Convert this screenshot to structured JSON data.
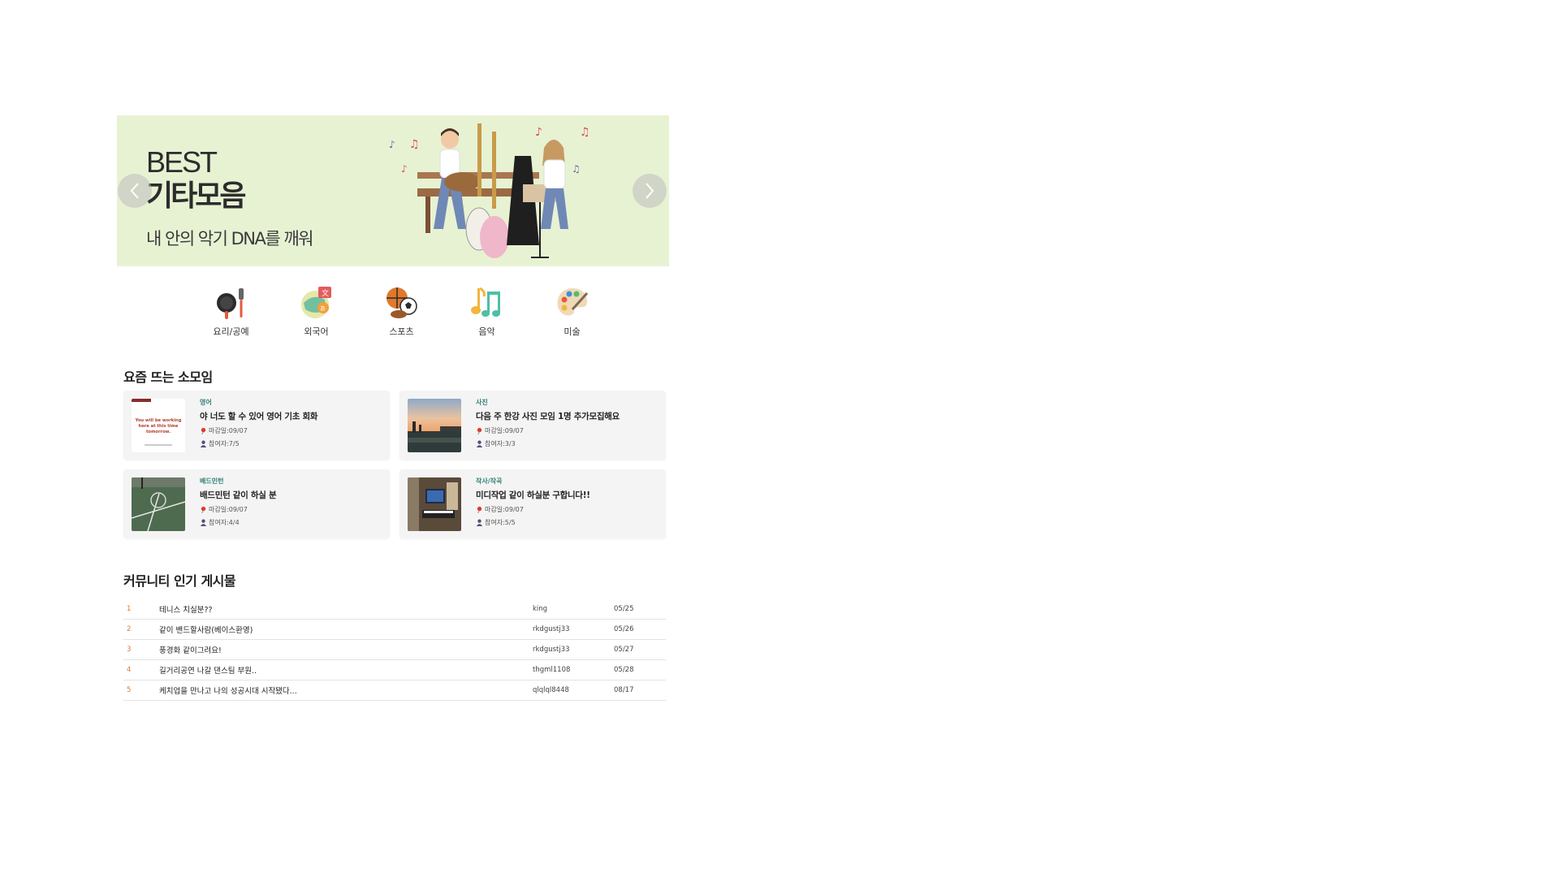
{
  "banner": {
    "best": "BEST",
    "title": "기타모음",
    "subtitle": "내 안의 악기 DNA를 깨워",
    "background": "#e7f2d3"
  },
  "categories": [
    {
      "label": "요리/공예",
      "icon": "frying-pan-icon"
    },
    {
      "label": "외국어",
      "icon": "language-globe-icon"
    },
    {
      "label": "스포츠",
      "icon": "sports-balls-icon"
    },
    {
      "label": "음악",
      "icon": "music-notes-icon"
    },
    {
      "label": "미술",
      "icon": "palette-icon"
    }
  ],
  "meetups": {
    "title": "요즘 뜨는 소모임",
    "deadline_prefix": "마감일: ",
    "members_prefix": "참여자: ",
    "items": [
      {
        "category": "영어",
        "title": "야 너도 할 수 있어 영어 기초 회화",
        "deadline": "09/07",
        "members": "7/5",
        "thumb_text": "You will be working here at this time tomorrow."
      },
      {
        "category": "사진",
        "title": "다음 주 한강 사진 모임 1명 추가모집해요",
        "deadline": "09/07",
        "members": "3/3"
      },
      {
        "category": "배드민턴",
        "title": "배드민턴 같이 하실 분",
        "deadline": "09/07",
        "members": "4/4"
      },
      {
        "category": "작사/작곡",
        "title": "미디작업 같이 하실분 구합니다!!",
        "deadline": "09/07",
        "members": "5/5"
      }
    ]
  },
  "community": {
    "title": "커뮤니티 인기 게시물",
    "posts": [
      {
        "num": "1",
        "title": "테니스 치실분??",
        "author": "king",
        "date": "05/25"
      },
      {
        "num": "2",
        "title": "같이 밴드할사람(베이스환영)",
        "author": "rkdgustj33",
        "date": "05/26"
      },
      {
        "num": "3",
        "title": "풍경화 같이그려요!",
        "author": "rkdgustj33",
        "date": "05/27"
      },
      {
        "num": "4",
        "title": "길거리공연 나갈 댄스팀 부원..",
        "author": "thgml1108",
        "date": "05/28"
      },
      {
        "num": "5",
        "title": "케치업을 만나고 나의 성공시대 시작됐다...",
        "author": "qlqlql8448",
        "date": "08/17"
      }
    ]
  },
  "colors": {
    "accent_number": "#e07b2c",
    "category_tag": "#2f7f76",
    "card_bg": "#f4f4f4"
  }
}
